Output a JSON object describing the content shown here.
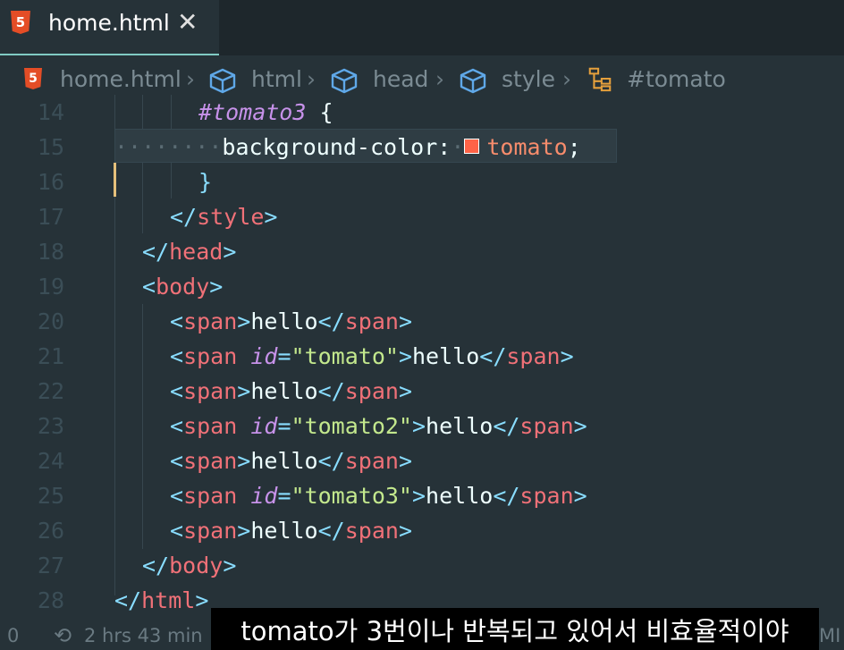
{
  "tab": {
    "title": "home.html",
    "close_icon": "close-icon",
    "file_icon": "html5-icon"
  },
  "breadcrumb": [
    "home.html",
    "html",
    "head",
    "style",
    "#tomato"
  ],
  "code": {
    "line_numbers": [
      "14",
      "15",
      "16",
      "17",
      "18",
      "19",
      "20",
      "21",
      "22",
      "23",
      "24",
      "25",
      "26",
      "27",
      "28"
    ],
    "selector": "#tomato3",
    "property": "background-color",
    "value": "tomato",
    "swatch_color": "#ff6347",
    "tags": {
      "style": "style",
      "head": "head",
      "body": "body",
      "span": "span",
      "html": "html",
      "id_attr": "id",
      "text": "hello"
    },
    "ids": [
      "\"tomato\"",
      "\"tomato2\"",
      "\"tomato3\""
    ]
  },
  "status": {
    "left": "0",
    "time": "2 hrs 43 min",
    "right": "MI"
  },
  "subtitle": "tomato가 3번이나 반복되고 있어서 비효율적이야",
  "colors": {
    "background": "#263238",
    "tag": "#f07178",
    "punctuation": "#89ddff",
    "attribute": "#c792ea",
    "string": "#c3e88d",
    "value": "#f78c6c"
  }
}
